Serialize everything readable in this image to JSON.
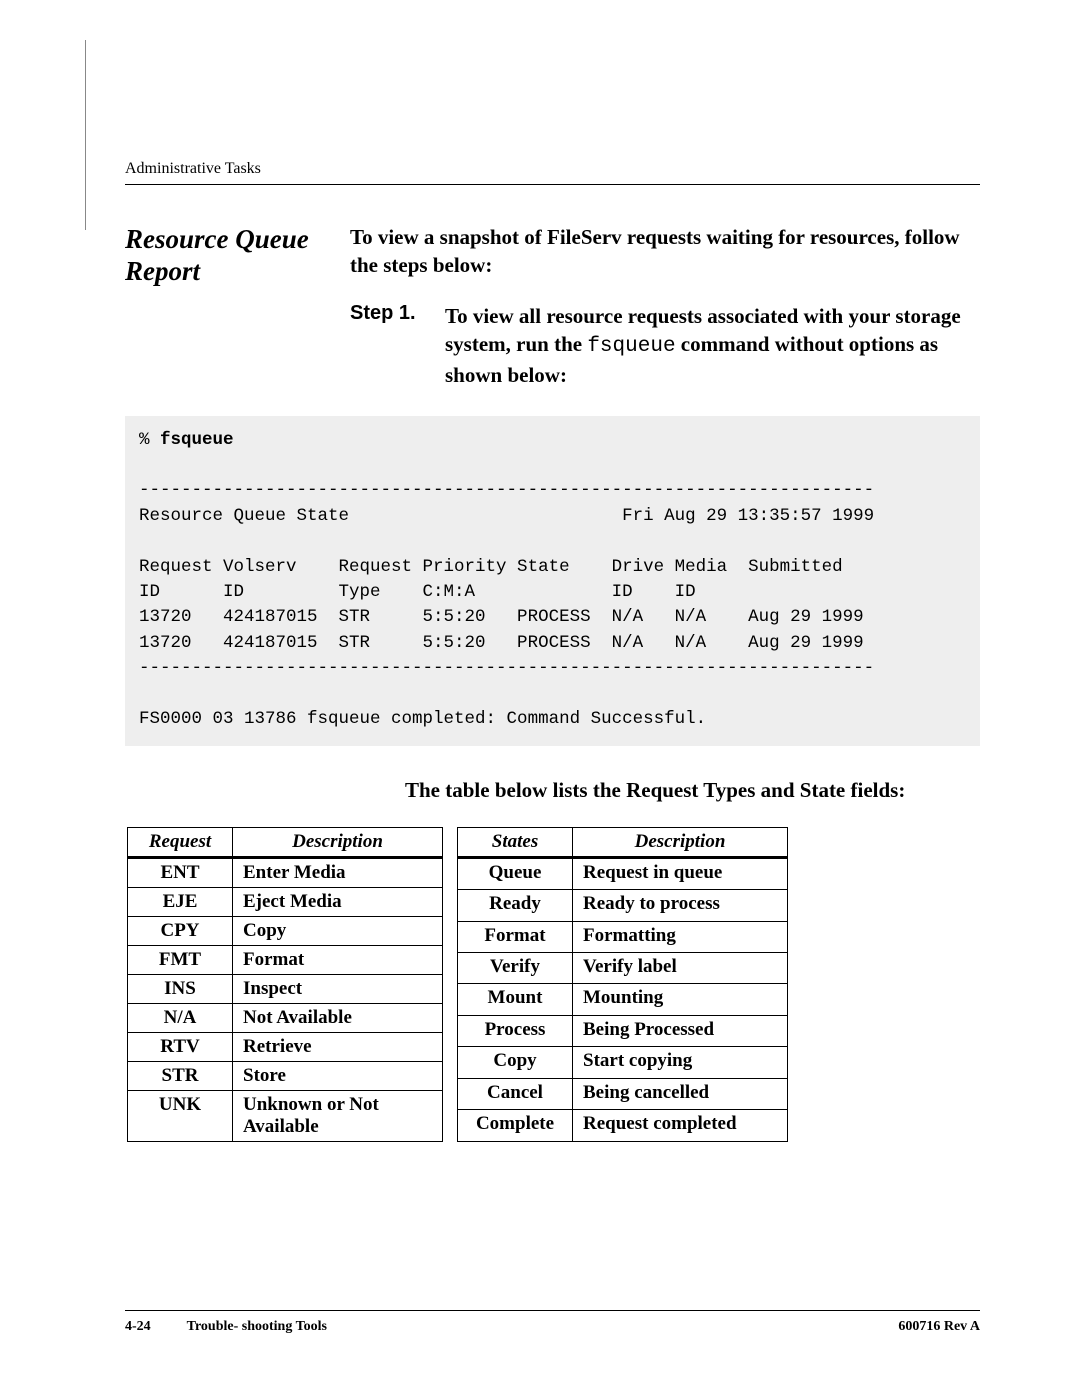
{
  "running_head": "Administrative Tasks",
  "section_title": "Resource Queue Report",
  "intro": "To view a snapshot of FileServ requests waiting for resources, follow the steps below:",
  "step": {
    "label": "Step 1.",
    "text_before_cmd": "To view all resource requests associated with your storage system, run the ",
    "cmd": "fsqueue",
    "text_after_cmd": " command without options as shown below:"
  },
  "terminal": {
    "prompt": "% ",
    "command": "fsqueue",
    "divider": "----------------------------------------------------------------------",
    "state_title": "Resource Queue State",
    "state_time": "Fri Aug 29 13:35:57 1999",
    "hdr1": "Request Volserv    Request Priority State    Drive Media  Submitted",
    "hdr2": "ID      ID         Type    C:M:A             ID    ID",
    "row1": "13720   424187015  STR     5:5:20   PROCESS  N/A   N/A    Aug 29 1999",
    "row2": "13720   424187015  STR     5:5:20   PROCESS  N/A   N/A    Aug 29 1999",
    "footer_msg": "FS0000 03 13786 fsqueue completed: Command Successful."
  },
  "table_caption": "The table below lists the Request Types and State fields:",
  "request_table": {
    "headers": [
      "Request",
      "Description"
    ],
    "rows": [
      {
        "key": "ENT",
        "val": "Enter Media"
      },
      {
        "key": "EJE",
        "val": "Eject Media"
      },
      {
        "key": "CPY",
        "val": "Copy"
      },
      {
        "key": "FMT",
        "val": "Format"
      },
      {
        "key": "INS",
        "val": "Inspect"
      },
      {
        "key": "N/A",
        "val": "Not Available"
      },
      {
        "key": "RTV",
        "val": "Retrieve"
      },
      {
        "key": "STR",
        "val": "Store"
      },
      {
        "key": "UNK",
        "val": "Unknown or Not Available"
      }
    ]
  },
  "states_table": {
    "headers": [
      "States",
      "Description"
    ],
    "rows": [
      {
        "key": "Queue",
        "val": "Request in queue"
      },
      {
        "key": "Ready",
        "val": "Ready to process"
      },
      {
        "key": "Format",
        "val": "Formatting"
      },
      {
        "key": "Verify",
        "val": "Verify label"
      },
      {
        "key": "Mount",
        "val": "Mounting"
      },
      {
        "key": "Process",
        "val": "Being Processed"
      },
      {
        "key": "Copy",
        "val": "Start copying"
      },
      {
        "key": "Cancel",
        "val": "Being cancelled"
      },
      {
        "key": "Complete",
        "val": "Request completed"
      }
    ]
  },
  "footer": {
    "page_number": "4-24",
    "chapter": "Trouble- shooting Tools",
    "doc_rev": "600716 Rev A"
  }
}
